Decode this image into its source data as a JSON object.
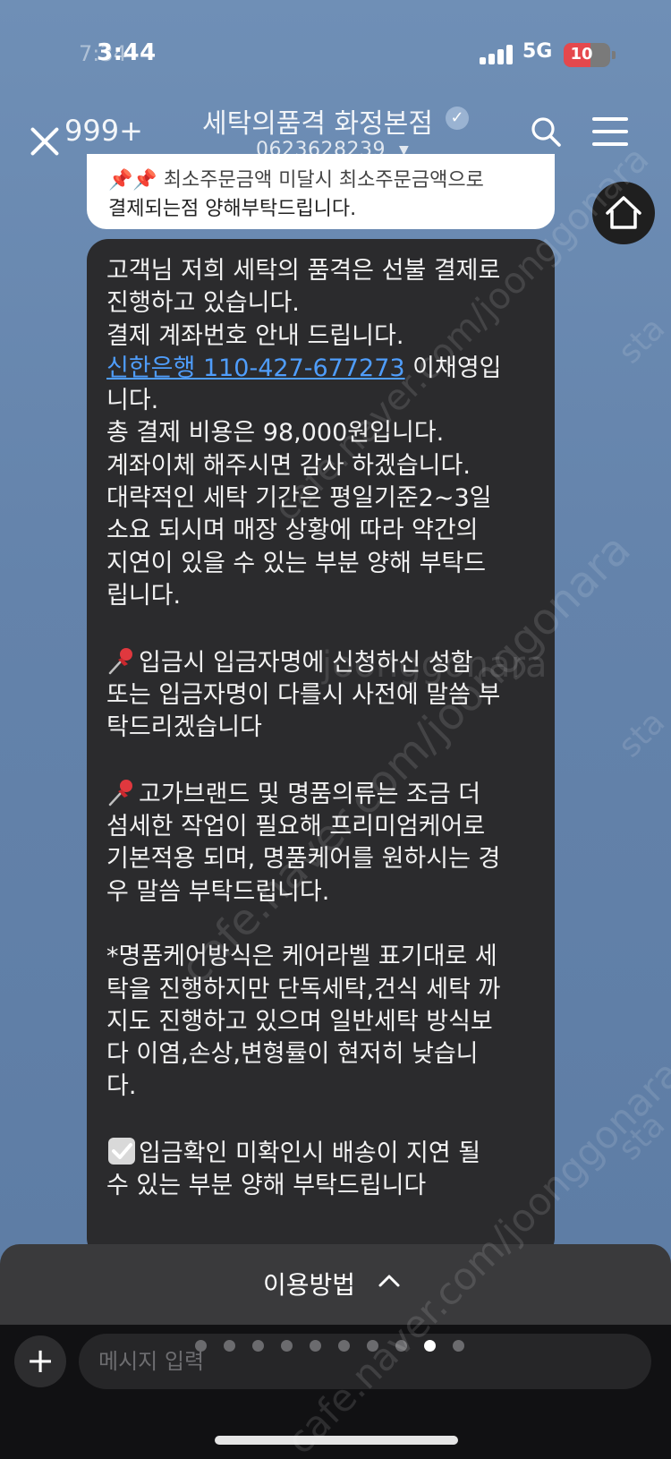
{
  "status_bar": {
    "time": "3:44",
    "time_ghost": "7:34",
    "network": "5G",
    "battery": "10",
    "battery_level": 0.1
  },
  "header": {
    "unread_count": "999+",
    "title": "세탁의품격 화정본점",
    "phone": "0623628239"
  },
  "notice": {
    "line1": "📌📌 최소주문금액 미달시 최소주문금액으로",
    "line2": "결제되는점 양해부탁드립니다."
  },
  "message": {
    "l1": "고객님 저희 세탁의 품격은 선불 결제로",
    "l2": "진행하고 있습니다.",
    "l3": "결제 계좌번호 안내 드립니다.",
    "bank": "신한은행 110-427-677273",
    "l4_tail": " 이채영입",
    "l5": "니다.",
    "l6": "총 결제 비용은 98,000원입니다.",
    "l7": "계좌이체 해주시면 감사 하겠습니다.",
    "l8": "대략적인 세탁 기간은 평일기준2~3일",
    "l9": "소요 되시며 매장 상황에 따라 약간의",
    "l10": "지연이 있을 수 있는 부분 양해 부탁드",
    "l11": "립니다.",
    "l12": "입금시 입금자명에 신청하신 성함",
    "l13": "또는 입금자명이 다를시 사전에 말씀 부",
    "l14": "탁드리겠습니다",
    "l15": "고가브랜드 및 명품의류는 조금 더",
    "l16": "섬세한 작업이 필요해 프리미엄케어로",
    "l17": "기본적용 되며, 명품케어를 원하시는 경",
    "l18": "우 말씀 부탁드립니다.",
    "l19": "*명품케어방식은 케어라벨 표기대로 세",
    "l20": "탁을 진행하지만 단독세탁,건식 세탁 까",
    "l21": "지도 진행하고 있으며 일반세탁 방식보",
    "l22": "다 이염,손상,변형률이 현저히 낮습니",
    "l23": "다.",
    "l24": "입금확인 미확인시 배송이 지연 될",
    "l25": "수 있는 부분 양해 부탁드립니다"
  },
  "menu_bar": {
    "label": "이용방법"
  },
  "input": {
    "placeholder": "메시지 입력"
  },
  "pagination": {
    "total": 10,
    "active_index": 8
  },
  "watermarks": [
    "cafe.naver.com/joonggonara",
    "joonggonara",
    "sta"
  ]
}
